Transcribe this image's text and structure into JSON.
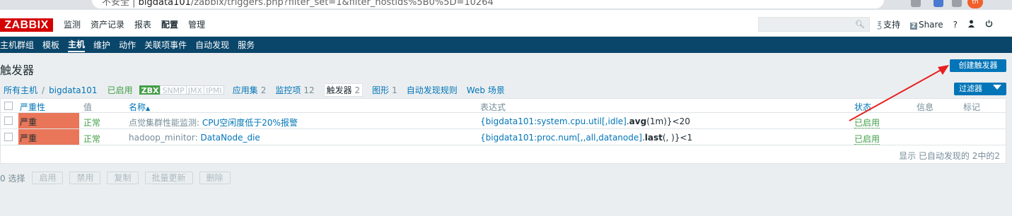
{
  "browser": {
    "url_host": "bigdata101",
    "url_path": "/zabbix/triggers.php?filter_set=1&filter_hostids%5B0%5D=10264",
    "security_label": "不安全",
    "avatar_text": "tn"
  },
  "header": {
    "logo": "ZABBIX",
    "nav": [
      "监测",
      "资产记录",
      "报表",
      "配置",
      "管理"
    ],
    "active_nav": "配置",
    "search_placeholder": "",
    "support": "支持",
    "share": "Share",
    "help": "?",
    "share_box": "Z"
  },
  "subnav": {
    "items": [
      "主机群组",
      "模板",
      "主机",
      "维护",
      "动作",
      "关联项事件",
      "自动发现",
      "服务"
    ],
    "active": "主机"
  },
  "page": {
    "title": "触发器",
    "create_button": "创建触发器",
    "filter_button": "过滤器"
  },
  "hostline": {
    "all_hosts": "所有主机",
    "separator": "/",
    "host": "bigdata101",
    "enabled": "已启用",
    "availability": [
      "ZBX",
      "SNMP",
      "JMX",
      "IPMI"
    ],
    "links": [
      {
        "label": "应用集",
        "count": "2"
      },
      {
        "label": "监控项",
        "count": "12"
      },
      {
        "label": "触发器",
        "count": "2"
      },
      {
        "label": "图形",
        "count": "1"
      },
      {
        "label": "自动发现规则",
        "count": ""
      },
      {
        "label": "Web 场景",
        "count": ""
      }
    ]
  },
  "table": {
    "headers": {
      "severity": "严重性",
      "value": "值",
      "name": "名称",
      "sort_arrow": "▲",
      "expression": "表达式",
      "status": "状态",
      "info": "信息",
      "tags": "标记"
    },
    "rows": [
      {
        "severity": "严重",
        "value": "正常",
        "name_prefix": "点觉集群性能监测:",
        "name_link": "CPU空闲度低于20%报警",
        "expr_key": "{bigdata101:system.cpu.util[,idle]",
        "expr_dot": ".",
        "expr_func": "avg",
        "expr_args": "(1m)}",
        "expr_op": "<20",
        "status": "已启用"
      },
      {
        "severity": "严重",
        "value": "正常",
        "name_prefix": "hadoop_minitor:",
        "name_link": "DataNode_die",
        "expr_key": "{bigdata101:proc.num[,,all,datanode]",
        "expr_dot": ".",
        "expr_func": "last",
        "expr_args": "(, )}",
        "expr_op": "<1",
        "status": "已启用"
      }
    ],
    "footer": "显示 已自动发现的 2中的2"
  },
  "actions": {
    "count": "0 选择",
    "buttons": [
      "启用",
      "禁用",
      "复制",
      "批量更新",
      "删除"
    ]
  },
  "colors": {
    "header_dark": "#0a466a",
    "accent_blue": "#0275b8",
    "status_green": "#429e47",
    "severity_high": "#e97659",
    "annotation_red": "#e8201f"
  }
}
